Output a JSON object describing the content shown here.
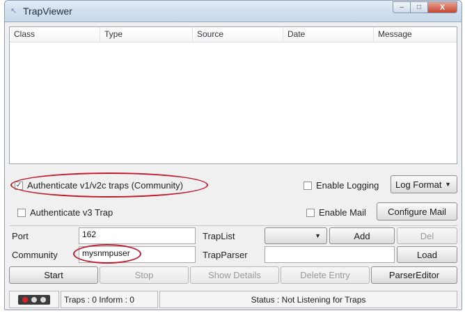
{
  "window": {
    "title": "TrapViewer",
    "controls": {
      "minimize": "–",
      "maximize": "□",
      "close": "X"
    }
  },
  "table": {
    "columns": [
      "Class",
      "Type",
      "Source",
      "Date",
      "Message"
    ],
    "rows": []
  },
  "options": {
    "authenticate_v1v2c": {
      "label": "Authenticate v1/v2c traps (Community)",
      "checked": true
    },
    "authenticate_v3": {
      "label": "Authenticate v3 Trap",
      "checked": false
    },
    "enable_logging": {
      "label": "Enable Logging",
      "checked": false
    },
    "enable_mail": {
      "label": "Enable Mail",
      "checked": false
    },
    "log_format_label": "Log Format",
    "configure_mail_label": "Configure Mail"
  },
  "form": {
    "port_label": "Port",
    "port_value": "162",
    "community_label": "Community",
    "community_value": "mysnmpuser",
    "traplist_label": "TrapList",
    "traplist_value": "",
    "trapparser_label": "TrapParser",
    "trapparser_value": "",
    "add_label": "Add",
    "del_label": "Del",
    "load_label": "Load"
  },
  "actions": {
    "start": "Start",
    "stop": "Stop",
    "show_details": "Show Details",
    "delete_entry": "Delete Entry",
    "parser_editor": "ParserEditor"
  },
  "status": {
    "counts": "Traps : 0 Inform : 0",
    "message": "Status : Not Listening for Traps"
  },
  "colors": {
    "highlight_ellipse": "#c0182c",
    "led_active": "#d8232a"
  }
}
